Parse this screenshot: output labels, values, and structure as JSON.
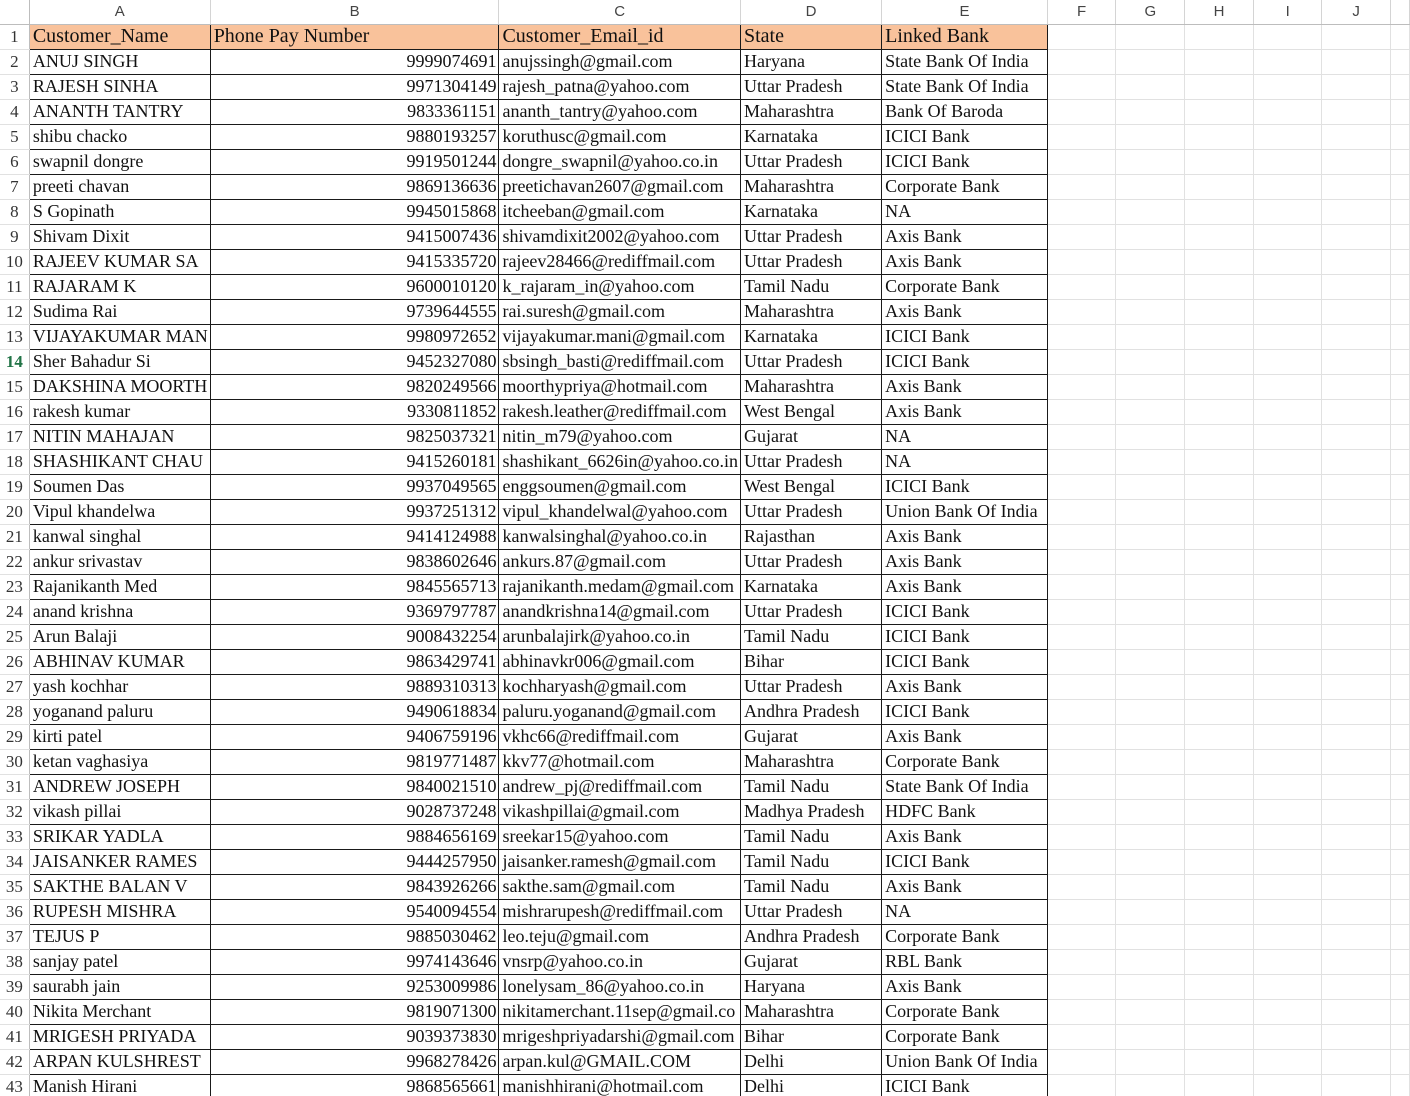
{
  "column_letters": [
    "A",
    "B",
    "C",
    "D",
    "E",
    "F",
    "G",
    "H",
    "I",
    "J"
  ],
  "active_row": 14,
  "header": {
    "customer_name": "Customer_Name",
    "phone": "Phone Pay Number",
    "email": "Customer_Email_id",
    "state": "State",
    "bank": "Linked Bank"
  },
  "rows": [
    [
      "ANUJ SINGH",
      "9999074691",
      "anujssingh@gmail.com",
      "Haryana",
      "State Bank Of India"
    ],
    [
      "RAJESH SINHA",
      "9971304149",
      "rajesh_patna@yahoo.com",
      "Uttar Pradesh",
      "State Bank Of India"
    ],
    [
      "ANANTH TANTRY",
      "9833361151",
      "ananth_tantry@yahoo.com",
      "Maharashtra",
      "Bank Of Baroda"
    ],
    [
      "shibu chacko",
      "9880193257",
      "koruthusc@gmail.com",
      "Karnataka",
      "ICICI Bank"
    ],
    [
      "swapnil dongre",
      "9919501244",
      "dongre_swapnil@yahoo.co.in",
      "Uttar Pradesh",
      "ICICI Bank"
    ],
    [
      "preeti chavan",
      "9869136636",
      "preetichavan2607@gmail.com",
      "Maharashtra",
      "Corporate Bank"
    ],
    [
      "S Gopinath",
      "9945015868",
      "itcheeban@gmail.com",
      "Karnataka",
      "NA"
    ],
    [
      "Shivam Dixit",
      "9415007436",
      "shivamdixit2002@yahoo.com",
      "Uttar Pradesh",
      "Axis Bank"
    ],
    [
      "RAJEEV KUMAR SA",
      "9415335720",
      "rajeev28466@rediffmail.com",
      "Uttar Pradesh",
      "Axis Bank"
    ],
    [
      "RAJARAM K",
      "9600010120",
      "k_rajaram_in@yahoo.com",
      "Tamil Nadu",
      "Corporate Bank"
    ],
    [
      "Sudima Rai",
      "9739644555",
      "rai.suresh@gmail.com",
      "Maharashtra",
      "Axis Bank"
    ],
    [
      "VIJAYAKUMAR MAN",
      "9980972652",
      "vijayakumar.mani@gmail.com",
      "Karnataka",
      "ICICI Bank"
    ],
    [
      "Sher Bahadur Si",
      "9452327080",
      "sbsingh_basti@rediffmail.com",
      "Uttar Pradesh",
      "ICICI Bank"
    ],
    [
      "DAKSHINA MOORTH",
      "9820249566",
      "moorthypriya@hotmail.com",
      "Maharashtra",
      "Axis Bank"
    ],
    [
      "rakesh kumar",
      "9330811852",
      "rakesh.leather@rediffmail.com",
      "West Bengal",
      "Axis Bank"
    ],
    [
      "NITIN MAHAJAN",
      "9825037321",
      "nitin_m79@yahoo.com",
      "Gujarat",
      "NA"
    ],
    [
      "SHASHIKANT CHAU",
      "9415260181",
      "shashikant_6626in@yahoo.co.in",
      "Uttar Pradesh",
      "NA"
    ],
    [
      "Soumen Das",
      "9937049565",
      "enggsoumen@gmail.com",
      "West Bengal",
      "ICICI Bank"
    ],
    [
      "Vipul khandelwa",
      "9937251312",
      "vipul_khandelwal@yahoo.com",
      "Uttar Pradesh",
      "Union Bank Of India"
    ],
    [
      "kanwal singhal",
      "9414124988",
      "kanwalsinghal@yahoo.co.in",
      "Rajasthan",
      "Axis Bank"
    ],
    [
      "ankur srivastav",
      "9838602646",
      "ankurs.87@gmail.com",
      "Uttar Pradesh",
      "Axis Bank"
    ],
    [
      "Rajanikanth Med",
      "9845565713",
      "rajanikanth.medam@gmail.com",
      "Karnataka",
      "Axis Bank"
    ],
    [
      "anand krishna",
      "9369797787",
      "anandkrishna14@gmail.com",
      "Uttar Pradesh",
      "ICICI Bank"
    ],
    [
      "Arun Balaji",
      "9008432254",
      "arunbalajirk@yahoo.co.in",
      "Tamil Nadu",
      "ICICI Bank"
    ],
    [
      "ABHINAV KUMAR",
      "9863429741",
      "abhinavkr006@gmail.com",
      "Bihar",
      "ICICI Bank"
    ],
    [
      "yash kochhar",
      "9889310313",
      "kochharyash@gmail.com",
      "Uttar Pradesh",
      "Axis Bank"
    ],
    [
      "yoganand paluru",
      "9490618834",
      "paluru.yoganand@gmail.com",
      "Andhra Pradesh",
      "ICICI Bank"
    ],
    [
      "kirti patel",
      "9406759196",
      "vkhc66@rediffmail.com",
      "Gujarat",
      "Axis Bank"
    ],
    [
      "ketan vaghasiya",
      "9819771487",
      "kkv77@hotmail.com",
      "Maharashtra",
      "Corporate Bank"
    ],
    [
      "ANDREW JOSEPH",
      "9840021510",
      "andrew_pj@rediffmail.com",
      "Tamil Nadu",
      "State Bank Of India"
    ],
    [
      "vikash pillai",
      "9028737248",
      "vikashpillai@gmail.com",
      "Madhya Pradesh",
      "HDFC Bank"
    ],
    [
      "SRIKAR YADLA",
      "9884656169",
      "sreekar15@yahoo.com",
      "Tamil Nadu",
      "Axis Bank"
    ],
    [
      "JAISANKER RAMES",
      "9444257950",
      "jaisanker.ramesh@gmail.com",
      "Tamil Nadu",
      "ICICI Bank"
    ],
    [
      "SAKTHE BALAN V",
      "9843926266",
      "sakthe.sam@gmail.com",
      "Tamil Nadu",
      "Axis Bank"
    ],
    [
      "RUPESH MISHRA",
      "9540094554",
      "mishrarupesh@rediffmail.com",
      "Uttar Pradesh",
      "NA"
    ],
    [
      "TEJUS P",
      "9885030462",
      "leo.teju@gmail.com",
      "Andhra Pradesh",
      "Corporate Bank"
    ],
    [
      "sanjay patel",
      "9974143646",
      "vnsrp@yahoo.co.in",
      "Gujarat",
      "RBL Bank"
    ],
    [
      "saurabh jain",
      "9253009986",
      "lonelysam_86@yahoo.co.in",
      "Haryana",
      "Axis Bank"
    ],
    [
      "Nikita Merchant",
      "9819071300",
      "nikitamerchant.11sep@gmail.co",
      "Maharashtra",
      "Corporate Bank"
    ],
    [
      "MRIGESH PRIYADA",
      "9039373830",
      "mrigeshpriyadarshi@gmail.com",
      "Bihar",
      "Corporate Bank"
    ],
    [
      "ARPAN KULSHREST",
      "9968278426",
      "arpan.kul@GMAIL.COM",
      "Delhi",
      "Union Bank Of India"
    ],
    [
      "Manish Hirani",
      "9868565661",
      "manishhirani@hotmail.com",
      "Delhi",
      "ICICI Bank"
    ]
  ]
}
